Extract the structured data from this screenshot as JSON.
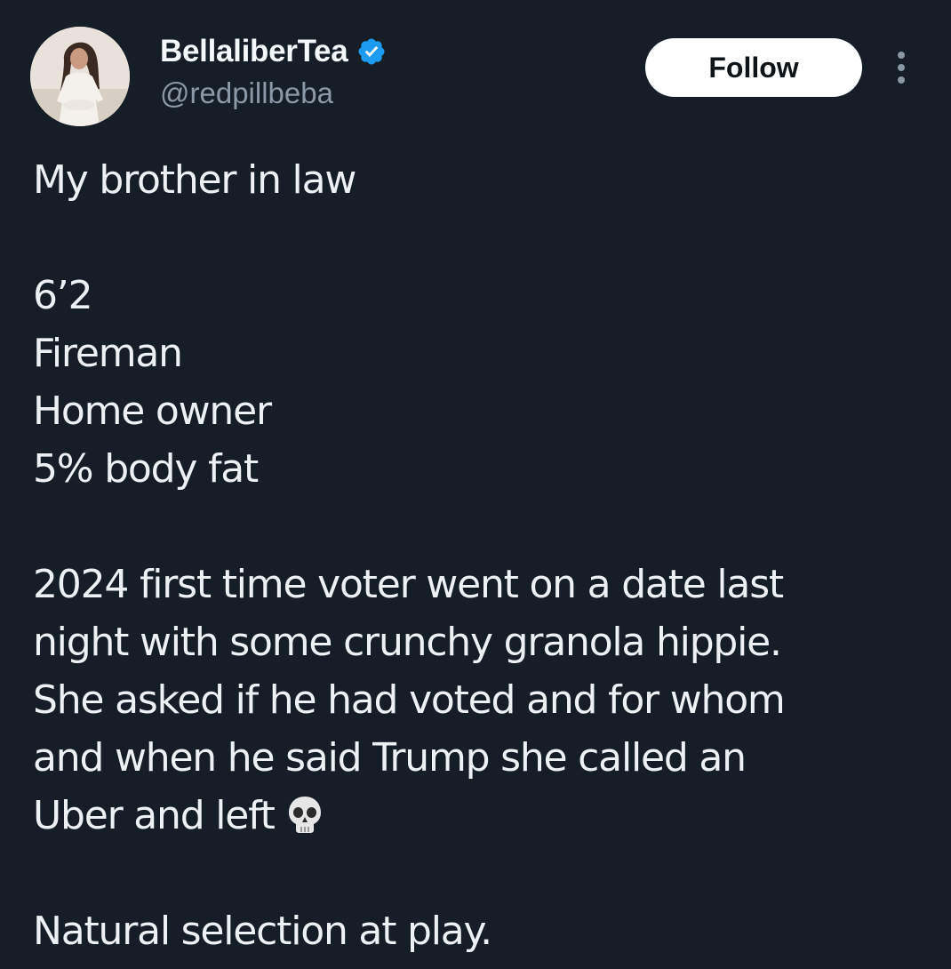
{
  "user": {
    "display_name": "BellaliberTea",
    "handle": "@redpillbeba",
    "verified": true,
    "verified_color": "#1d9bf0"
  },
  "actions": {
    "follow_label": "Follow",
    "more_icon": "more-vertical-icon"
  },
  "tweet": {
    "lines": [
      "My brother in law",
      "",
      "6’2",
      "Fireman",
      "Home owner",
      "5% body fat",
      "",
      "2024 first time voter went on a date last",
      "night with some crunchy granola hippie.",
      "She asked if he had voted and for whom",
      "and when he said Trump she called an",
      "Uber and left",
      "",
      "Natural selection at play."
    ],
    "emoji": "skull-emoji"
  },
  "colors": {
    "background": "#151d27",
    "text": "#eef1f4",
    "handle": "#8b98a5"
  }
}
